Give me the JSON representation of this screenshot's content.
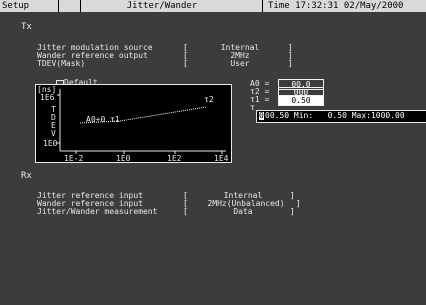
{
  "header": {
    "menu": "Setup",
    "title": "Jitter/Wander",
    "time": "Time 17:32:31 02/May/2000"
  },
  "tx": {
    "section": "Tx",
    "rows": [
      {
        "label": "Jitter modulation source",
        "value": "Internal"
      },
      {
        "label": "Wander reference output",
        "value": "2MHz"
      },
      {
        "label": "TDEV(Mask)",
        "value": "User"
      }
    ]
  },
  "graph": {
    "default_label": "Default",
    "unit": "[ns]",
    "y_ticks": [
      "1E6",
      "1E0"
    ],
    "y_axis_letters": [
      "T",
      "D",
      "E",
      "V"
    ],
    "x_ticks": [
      "1E-2",
      "1E0",
      "1E2",
      "1E4"
    ],
    "point_a0": "A0+0 τ1",
    "point_t2": "τ2"
  },
  "params": {
    "a0_label": "A0 =",
    "a0_value": "00.0",
    "t2_label": "τ2 =",
    "t2_value": "000",
    "t1_label": "τ1 =",
    "t1_value": "0.50",
    "sym": "τ"
  },
  "popup": {
    "cursor": "0",
    "text": "00.50 Min:   0.50 Max:1000.00"
  },
  "rx": {
    "section": "Rx",
    "rows": [
      {
        "label": "Jitter reference input",
        "value": "Internal"
      },
      {
        "label": "Wander reference input",
        "value": "2MHz(Unbalanced)"
      },
      {
        "label": "Jitter/Wander measurement",
        "value": "Data"
      }
    ]
  }
}
